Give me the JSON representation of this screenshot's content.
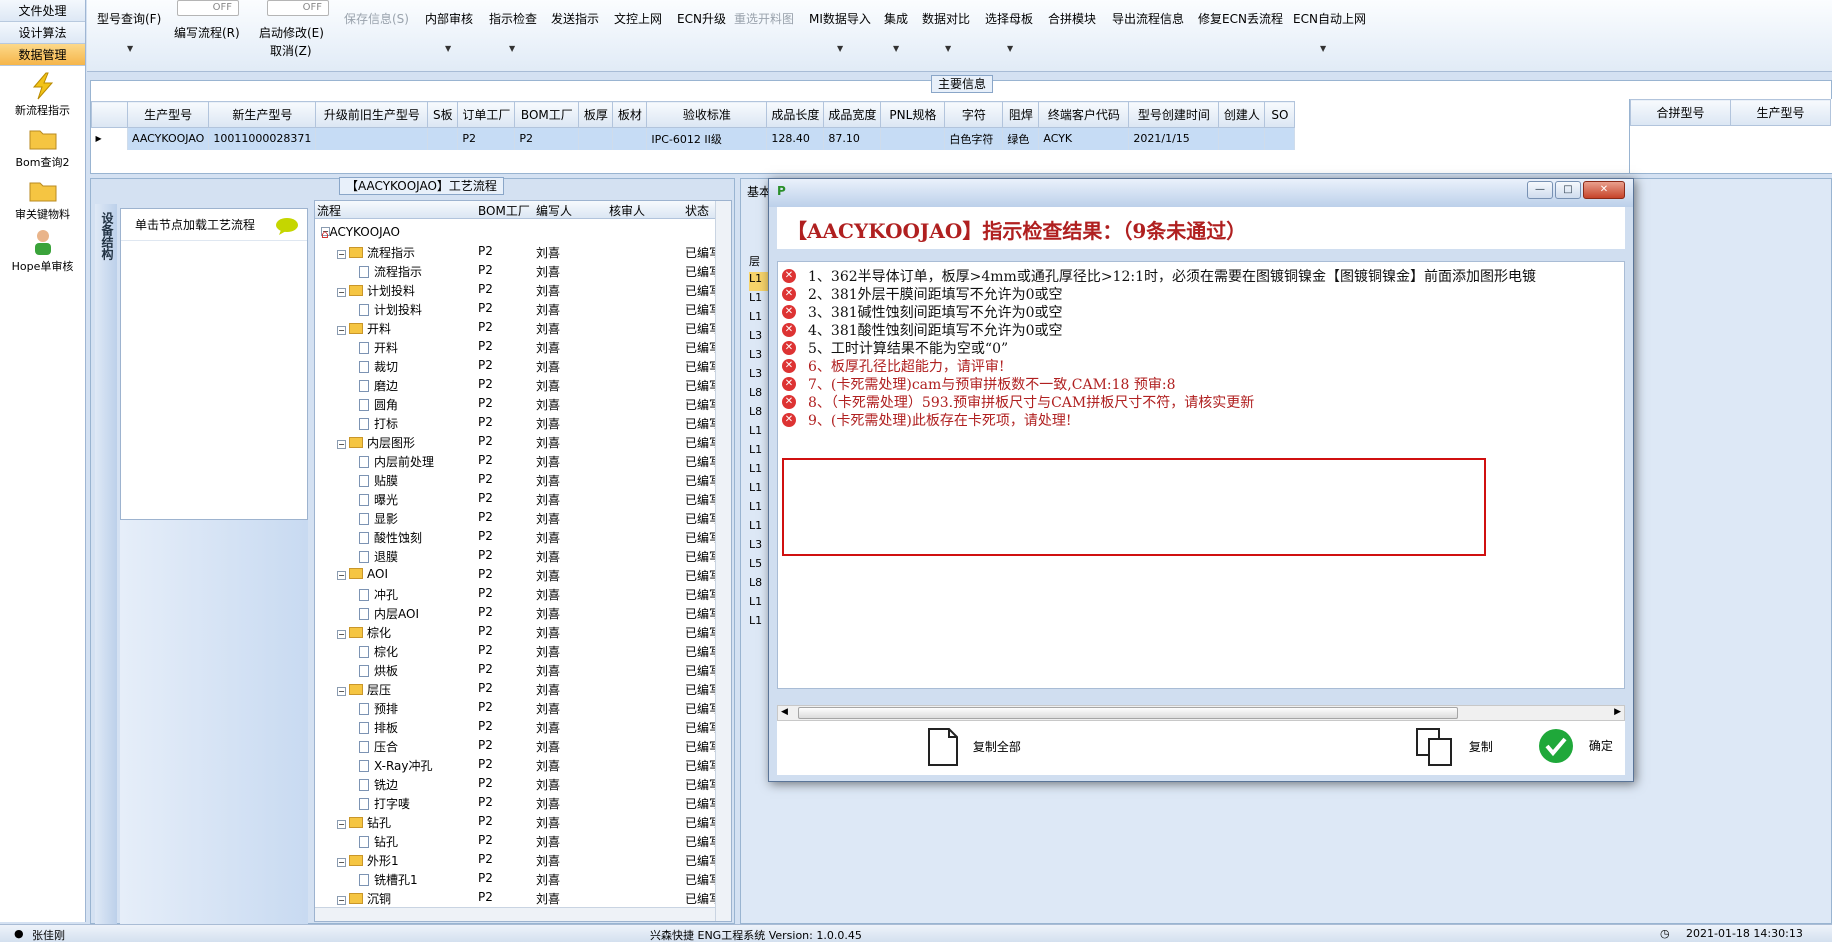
{
  "leftnav": {
    "tabs": [
      "文件处理",
      "设计算法",
      "数据管理"
    ],
    "items": [
      "新流程指示",
      "Bom查询2",
      "审关键物料",
      "Hope单审核"
    ]
  },
  "toolbar": {
    "buttons": [
      "型号查询(F)",
      "编写流程(R)",
      "启动修改(E)",
      "取消(Z)",
      "保存信息(S)",
      "内部审核",
      "指示检查",
      "发送指示",
      "文控上网",
      "ECN升级",
      "重选开料图",
      "MI数据导入",
      "集成",
      "数据对比",
      "选择母板",
      "合拼模块",
      "导出流程信息",
      "修复ECN丢流程",
      "ECN自动上网"
    ],
    "toggle_off": "OFF"
  },
  "main_info": {
    "legend": "主要信息",
    "columns": [
      "生产型号",
      "新生产型号",
      "升级前旧生产型号",
      "S板",
      "订单工厂",
      "BOM工厂",
      "板厚",
      "板材",
      "验收标准",
      "成品长度",
      "成品宽度",
      "PNL规格",
      "字符",
      "阻焊",
      "终端客户代码",
      "型号创建时间",
      "创建人",
      "SO"
    ],
    "row": [
      "AACYKOOJAO",
      "10011000028371",
      "",
      "",
      "P2",
      "P2",
      "",
      "",
      "IPC-6012 II级",
      "128.40",
      "87.10",
      "",
      "白色字符",
      "绿色",
      "ACYK",
      "2021/1/15",
      "",
      ""
    ],
    "side_columns": [
      "合拼型号",
      "生产型号"
    ]
  },
  "flow_panel": {
    "legend": "【AACYKOOJAO】工艺流程",
    "vtab": "设备结构",
    "hint": "单击节点加载工艺流程",
    "tree_columns": [
      "流程",
      "BOM工厂",
      "编写人",
      "核审人",
      "状态"
    ],
    "root": "AACYKOOJAO",
    "rows": [
      {
        "name": "流程指示",
        "level": 1,
        "bom": "P2",
        "author": "刘喜",
        "status": "已编写"
      },
      {
        "name": "流程指示",
        "level": 2,
        "bom": "P2",
        "author": "刘喜",
        "status": "已编写"
      },
      {
        "name": "计划投料",
        "level": 1,
        "bom": "P2",
        "author": "刘喜",
        "status": "已编写"
      },
      {
        "name": "计划投料",
        "level": 2,
        "bom": "P2",
        "author": "刘喜",
        "status": "已编写"
      },
      {
        "name": "开料",
        "level": 1,
        "bom": "P2",
        "author": "刘喜",
        "status": "已编写"
      },
      {
        "name": "开料",
        "level": 2,
        "bom": "P2",
        "author": "刘喜",
        "status": "已编写"
      },
      {
        "name": "裁切",
        "level": 2,
        "bom": "P2",
        "author": "刘喜",
        "status": "已编写"
      },
      {
        "name": "磨边",
        "level": 2,
        "bom": "P2",
        "author": "刘喜",
        "status": "已编写"
      },
      {
        "name": "圆角",
        "level": 2,
        "bom": "P2",
        "author": "刘喜",
        "status": "已编写"
      },
      {
        "name": "打标",
        "level": 2,
        "bom": "P2",
        "author": "刘喜",
        "status": "已编写"
      },
      {
        "name": "内层图形",
        "level": 1,
        "bom": "P2",
        "author": "刘喜",
        "status": "已编写"
      },
      {
        "name": "内层前处理",
        "level": 2,
        "bom": "P2",
        "author": "刘喜",
        "status": "已编写"
      },
      {
        "name": "贴膜",
        "level": 2,
        "bom": "P2",
        "author": "刘喜",
        "status": "已编写"
      },
      {
        "name": "曝光",
        "level": 2,
        "bom": "P2",
        "author": "刘喜",
        "status": "已编写"
      },
      {
        "name": "显影",
        "level": 2,
        "bom": "P2",
        "author": "刘喜",
        "status": "已编写"
      },
      {
        "name": "酸性蚀刻",
        "level": 2,
        "bom": "P2",
        "author": "刘喜",
        "status": "已编写"
      },
      {
        "name": "退膜",
        "level": 2,
        "bom": "P2",
        "author": "刘喜",
        "status": "已编写"
      },
      {
        "name": "AOI",
        "level": 1,
        "bom": "P2",
        "author": "刘喜",
        "status": "已编写"
      },
      {
        "name": "冲孔",
        "level": 2,
        "bom": "P2",
        "author": "刘喜",
        "status": "已编写"
      },
      {
        "name": "内层AOI",
        "level": 2,
        "bom": "P2",
        "author": "刘喜",
        "status": "已编写"
      },
      {
        "name": "棕化",
        "level": 1,
        "bom": "P2",
        "author": "刘喜",
        "status": "已编写"
      },
      {
        "name": "棕化",
        "level": 2,
        "bom": "P2",
        "author": "刘喜",
        "status": "已编写"
      },
      {
        "name": "烘板",
        "level": 2,
        "bom": "P2",
        "author": "刘喜",
        "status": "已编写"
      },
      {
        "name": "层压",
        "level": 1,
        "bom": "P2",
        "author": "刘喜",
        "status": "已编写"
      },
      {
        "name": "预排",
        "level": 2,
        "bom": "P2",
        "author": "刘喜",
        "status": "已编写"
      },
      {
        "name": "排板",
        "level": 2,
        "bom": "P2",
        "author": "刘喜",
        "status": "已编写"
      },
      {
        "name": "压合",
        "level": 2,
        "bom": "P2",
        "author": "刘喜",
        "status": "已编写"
      },
      {
        "name": "X-Ray冲孔",
        "level": 2,
        "bom": "P2",
        "author": "刘喜",
        "status": "已编写"
      },
      {
        "name": "铣边",
        "level": 2,
        "bom": "P2",
        "author": "刘喜",
        "status": "已编写"
      },
      {
        "name": "打字唛",
        "level": 2,
        "bom": "P2",
        "author": "刘喜",
        "status": "已编写"
      },
      {
        "name": "钻孔",
        "level": 1,
        "bom": "P2",
        "author": "刘喜",
        "status": "已编写"
      },
      {
        "name": "钻孔",
        "level": 2,
        "bom": "P2",
        "author": "刘喜",
        "status": "已编写"
      },
      {
        "name": "外形1",
        "level": 1,
        "bom": "P2",
        "author": "刘喜",
        "status": "已编写"
      },
      {
        "name": "铣槽孔1",
        "level": 2,
        "bom": "P2",
        "author": "刘喜",
        "status": "已编写"
      },
      {
        "name": "沉铜",
        "level": 1,
        "bom": "P2",
        "author": "刘喜",
        "status": "已编写"
      }
    ]
  },
  "right_panel": {
    "tab_label": "基本",
    "row_prefixes": [
      "层",
      "L1",
      "L1",
      "L1",
      "L3",
      "L3",
      "L3",
      "L8",
      "L8",
      "L1",
      "L1",
      "L1",
      "L1",
      "L1",
      "L1",
      "L3",
      "L5",
      "L8",
      "L1",
      "L1"
    ]
  },
  "dialog": {
    "header": "【AACYKOOJAO】指示检查结果：（9条未通过）",
    "items": [
      "1、362半导体订单，板厚>4mm或通孔厚径比>12:1时，必须在需要在图镀铜镍金【图镀铜镍金】前面添加图形电镀",
      "2、381外层干膜间距填写不允许为0或空",
      "3、381碱性蚀刻间距填写不允许为0或空",
      "4、381酸性蚀刻间距填写不允许为0或空",
      "5、工时计算结果不能为空或“0”",
      "6、板厚孔径比超能力，请评审!",
      "7、(卡死需处理)cam与预审拼板数不一致,CAM:18 预审:8",
      "8、（卡死需处理）593.预审拼板尺寸与CAM拼板尺寸不符，请核实更新",
      "9、(卡死需处理)此板存在卡死项，请处理!"
    ],
    "copy_all": "复制全部",
    "copy": "复制",
    "ok": "确定"
  },
  "statusbar": {
    "user": "张佳刚",
    "system": "兴森快捷 ENG工程系统 Version: 1.0.0.45",
    "datetime": "2021-01-18 14:30:13"
  },
  "colors": {
    "error_red": "#b02020",
    "item_dark": "#111111",
    "highlight_box": "#d01010"
  }
}
